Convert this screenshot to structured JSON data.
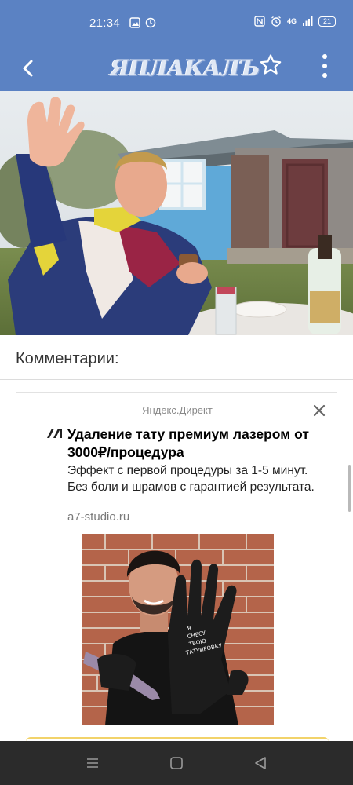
{
  "status_bar": {
    "time": "21:34",
    "battery": "21",
    "network": "4G",
    "left_icons": [
      "gallery-icon",
      "clock-icon"
    ],
    "right_icons": [
      "nfc-icon",
      "alarm-icon",
      "signal-icon",
      "battery-icon"
    ]
  },
  "app_bar": {
    "logo": "ЯПЛАКАЛЪ",
    "back_icon": "back-arrow-icon",
    "favorite_icon": "star-icon",
    "menu_icon": "more-vert-icon",
    "color": "#5b82c3"
  },
  "comments": {
    "title": "Комментарии:"
  },
  "ad": {
    "source": "Яндекс.Директ",
    "title": "Удаление тату премиум лазером от 3000₽/процедура",
    "description": "Эффект с первой процедуры за 1-5 минут. Без боли и шрамов с гарантией результата.",
    "domain": "a7-studio.ru",
    "glove_text": "Я СНЕСУ ТВОЮ ТАТУИРОВКУ"
  },
  "nav_bar": {
    "items": [
      "menu-icon",
      "home-icon",
      "back-triangle-icon"
    ]
  }
}
